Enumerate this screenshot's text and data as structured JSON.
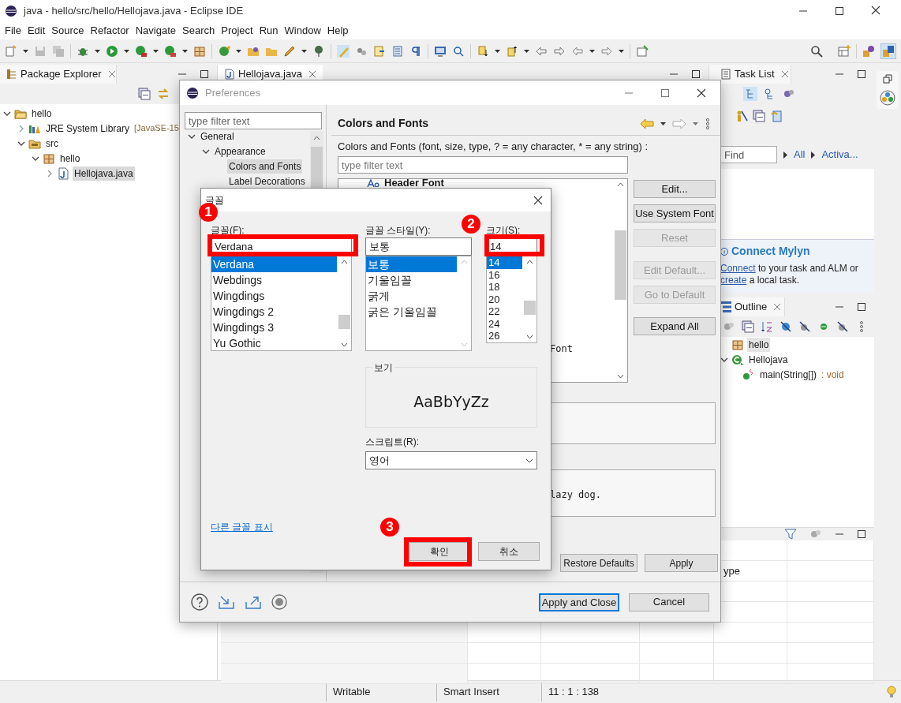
{
  "window": {
    "title": "java - hello/src/hello/Hellojava.java - Eclipse IDE"
  },
  "menu": [
    "File",
    "Edit",
    "Source",
    "Refactor",
    "Navigate",
    "Search",
    "Project",
    "Run",
    "Window",
    "Help"
  ],
  "package_explorer": {
    "title": "Package Explorer",
    "tree": [
      {
        "label": "hello",
        "kind": "project",
        "expanded": true,
        "selected": false,
        "children": [
          {
            "label": "JRE System Library",
            "suffix": "[JavaSE-15",
            "kind": "library",
            "expanded": false,
            "selected": false
          },
          {
            "label": "src",
            "kind": "folder",
            "expanded": true,
            "selected": false,
            "children": [
              {
                "label": "hello",
                "kind": "package",
                "expanded": true,
                "selected": false,
                "children": [
                  {
                    "label": "Hellojava.java",
                    "kind": "java",
                    "expanded": false,
                    "selected": true
                  }
                ]
              }
            ]
          }
        ]
      }
    ]
  },
  "editor": {
    "tab": "Hellojava.java"
  },
  "bottom_view": {
    "column_5": "ype"
  },
  "task_list": {
    "title": "Task List",
    "find_placeholder": "Find",
    "links": [
      "All",
      "Activa..."
    ]
  },
  "mylyn": {
    "title": "Connect Mylyn",
    "parts": [
      {
        "text": "Connect",
        "kind": "link"
      },
      {
        "text": " to your task and ALM or ",
        "kind": "text"
      },
      {
        "text": "create",
        "kind": "link"
      },
      {
        "text": " a local task.",
        "kind": "text"
      }
    ]
  },
  "outline": {
    "title": "Outline",
    "items": [
      {
        "label": "hello",
        "kind": "package",
        "selected": true
      },
      {
        "label": "Hellojava",
        "kind": "class",
        "selected": false,
        "expanded": true,
        "children": [
          {
            "label": "main(String[])",
            "type": " : void",
            "kind": "method",
            "selected": false
          }
        ]
      }
    ]
  },
  "status_bar": [
    "Writable",
    "Smart Insert",
    "11 : 1 : 138"
  ],
  "preferences": {
    "title": "Preferences",
    "filter_placeholder": "type filter text",
    "tree": [
      {
        "label": "General",
        "expanded": true,
        "selected": false,
        "children": [
          {
            "label": "Appearance",
            "expanded": true,
            "selected": false,
            "children": [
              {
                "label": "Colors and Fonts",
                "selected": true
              },
              {
                "label": "Label Decorations",
                "selected": false
              }
            ]
          }
        ]
      }
    ],
    "page_title": "Colors and Fonts",
    "description": "Colors and Fonts (font, size, type, ? = any character, * = any string) :",
    "page_filter_placeholder": "type filter text",
    "list": [
      {
        "label": "Header Font",
        "kind": "header"
      },
      {
        "label": "Font",
        "kind": "partial"
      }
    ],
    "preview_text": "lazy dog.",
    "side_buttons": [
      {
        "label": "Edit...",
        "disabled": false
      },
      {
        "label": "Use System Font",
        "disabled": false
      },
      {
        "label": "Reset",
        "disabled": true
      },
      {
        "label": "Edit Default...",
        "disabled": true
      },
      {
        "label": "Go to Default",
        "disabled": true
      },
      {
        "label": "Expand All",
        "disabled": false
      }
    ],
    "page_buttons": [
      "Restore Defaults",
      "Apply"
    ],
    "buttons": [
      {
        "label": "Apply and Close",
        "default": true
      },
      {
        "label": "Cancel",
        "default": false
      }
    ]
  },
  "font_dialog": {
    "title": "글꼴",
    "font_label": "글꼴(F):",
    "font_value": "Verdana",
    "fonts": [
      {
        "label": "Verdana",
        "selected": true
      },
      {
        "label": "Webdings",
        "selected": false
      },
      {
        "label": "Wingdings",
        "selected": false
      },
      {
        "label": "Wingdings 2",
        "selected": false
      },
      {
        "label": "Wingdings 3",
        "selected": false
      },
      {
        "label": "Yu Gothic",
        "selected": false
      }
    ],
    "style_label": "글꼴 스타일(Y):",
    "style_value": "보통",
    "styles": [
      {
        "label": "보통",
        "selected": true
      },
      {
        "label": "기울임꼴",
        "selected": false
      },
      {
        "label": "굵게",
        "selected": false
      },
      {
        "label": "굵은 기울임꼴",
        "selected": false
      }
    ],
    "size_label": "크기(S):",
    "size_value": "14",
    "sizes": [
      {
        "label": "14",
        "selected": true
      },
      {
        "label": "16",
        "selected": false
      },
      {
        "label": "18",
        "selected": false
      },
      {
        "label": "20",
        "selected": false
      },
      {
        "label": "22",
        "selected": false
      },
      {
        "label": "24",
        "selected": false
      },
      {
        "label": "26",
        "selected": false
      }
    ],
    "preview_label": "보기",
    "preview_text": "AaBbYyZz",
    "script_label": "스크립트(R):",
    "script_value": "영어",
    "more_fonts_link": "다른 글꼴 표시",
    "buttons": [
      "확인",
      "취소"
    ]
  },
  "annotations": [
    "1",
    "2",
    "3"
  ]
}
